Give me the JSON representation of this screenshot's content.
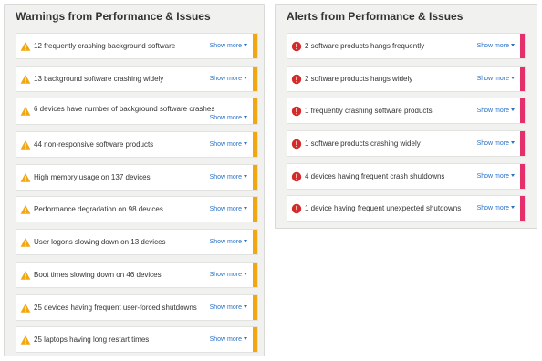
{
  "colors": {
    "warning_accent": "#f0a712",
    "alert_accent": "#e42f6b",
    "link": "#2a72c6",
    "panel_bg": "#f1f1ef"
  },
  "warnings": {
    "title": "Warnings from Performance & Issues",
    "icon": "warning-triangle-icon",
    "items": [
      {
        "text": "12 frequently crashing background software",
        "link": "Show more"
      },
      {
        "text": "13 background software crashing widely",
        "link": "Show more"
      },
      {
        "text": "6 devices have number of background software crashes",
        "link": "Show more"
      },
      {
        "text": "44 non-responsive software products",
        "link": "Show more"
      },
      {
        "text": "High memory usage on 137 devices",
        "link": "Show more"
      },
      {
        "text": "Performance degradation on 98 devices",
        "link": "Show more"
      },
      {
        "text": "User logons slowing down on 13 devices",
        "link": "Show more"
      },
      {
        "text": "Boot times slowing down on 46 devices",
        "link": "Show more"
      },
      {
        "text": "25 devices having frequent user-forced shutdowns",
        "link": "Show more"
      },
      {
        "text": "25 laptops having long restart times",
        "link": "Show more"
      }
    ]
  },
  "alerts": {
    "title": "Alerts from Performance & Issues",
    "icon": "error-circle-icon",
    "items": [
      {
        "text": "2 software products hangs frequently",
        "link": "Show more"
      },
      {
        "text": "2 software products hangs widely",
        "link": "Show more"
      },
      {
        "text": "1 frequently crashing software products",
        "link": "Show more"
      },
      {
        "text": "1 software products crashing widely",
        "link": "Show more"
      },
      {
        "text": "4 devices having frequent crash shutdowns",
        "link": "Show more"
      },
      {
        "text": "1 device having frequent unexpected shutdowns",
        "link": "Show more"
      }
    ]
  }
}
